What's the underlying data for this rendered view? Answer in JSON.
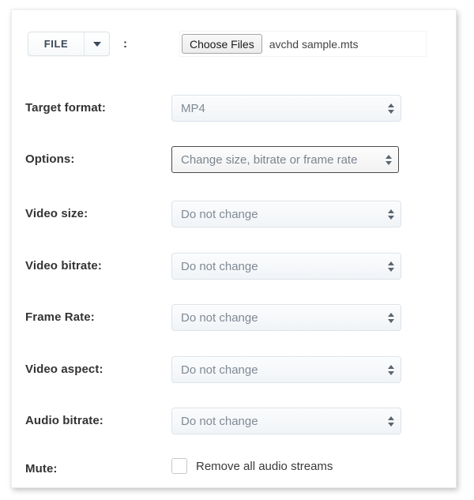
{
  "file_row": {
    "button_label": "FILE",
    "dropdown_icon": "chevron-down-icon",
    "separator": ":",
    "choose_files_label": "Choose Files",
    "file_name": "avchd sample.mts"
  },
  "fields": [
    {
      "key": "target_format",
      "label": "Target format:",
      "value": "MP4",
      "focused": false
    },
    {
      "key": "options",
      "label": "Options:",
      "value": "Change size, bitrate or frame rate",
      "focused": true
    },
    {
      "key": "video_size",
      "label": "Video size:",
      "value": "Do not change",
      "focused": false
    },
    {
      "key": "video_bitrate",
      "label": "Video bitrate:",
      "value": "Do not change",
      "focused": false
    },
    {
      "key": "frame_rate",
      "label": "Frame Rate:",
      "value": "Do not change",
      "focused": false
    },
    {
      "key": "video_aspect",
      "label": "Video aspect:",
      "value": "Do not change",
      "focused": false
    },
    {
      "key": "audio_bitrate",
      "label": "Audio bitrate:",
      "value": "Do not change",
      "focused": false
    }
  ],
  "mute_row": {
    "label": "Mute:",
    "checkbox_label": "Remove all audio streams",
    "checked": false
  },
  "colors": {
    "card_background": "#ffffff",
    "page_background": "#ffffff",
    "label_text": "#333333",
    "select_text": "#808a95",
    "select_border": "#dbe3ea",
    "focused_border": "#4a4a4a",
    "file_button_border": "#a6a6a6"
  },
  "layout": {
    "row_tops": [
      104,
      169,
      238,
      304,
      369,
      435,
      500,
      561
    ]
  }
}
